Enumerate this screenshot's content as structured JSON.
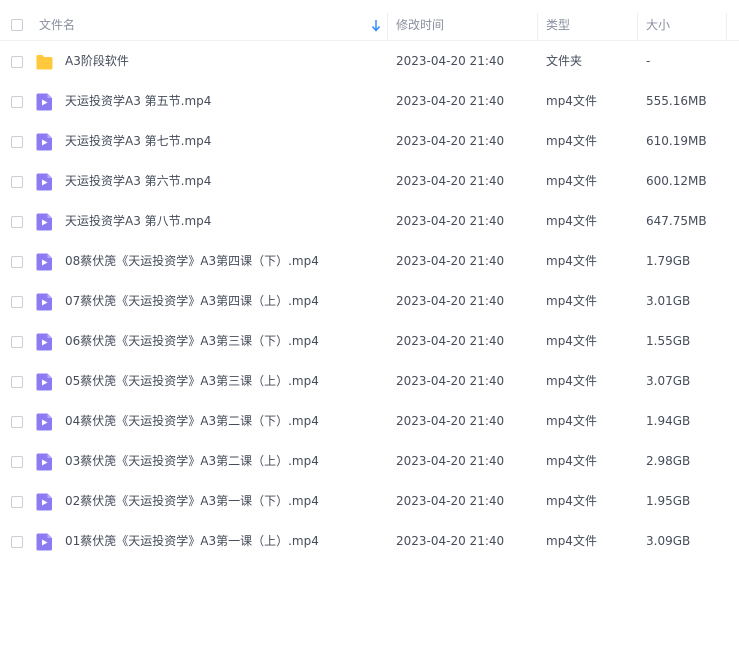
{
  "header": {
    "name_label": "文件名",
    "time_label": "修改时间",
    "type_label": "类型",
    "size_label": "大小"
  },
  "colors": {
    "folder": "#ffc83d",
    "video": "#8c7cf3",
    "header_text": "#8a90a0",
    "sort_arrow": "#2f8cff"
  },
  "rows": [
    {
      "icon": "folder-icon",
      "name": "A3阶段软件",
      "time": "2023-04-20 21:40",
      "type": "文件夹",
      "size": "-"
    },
    {
      "icon": "video-icon",
      "name": "天运投资学A3 第五节.mp4",
      "time": "2023-04-20 21:40",
      "type": "mp4文件",
      "size": "555.16MB"
    },
    {
      "icon": "video-icon",
      "name": "天运投资学A3 第七节.mp4",
      "time": "2023-04-20 21:40",
      "type": "mp4文件",
      "size": "610.19MB"
    },
    {
      "icon": "video-icon",
      "name": "天运投资学A3 第六节.mp4",
      "time": "2023-04-20 21:40",
      "type": "mp4文件",
      "size": "600.12MB"
    },
    {
      "icon": "video-icon",
      "name": "天运投资学A3 第八节.mp4",
      "time": "2023-04-20 21:40",
      "type": "mp4文件",
      "size": "647.75MB"
    },
    {
      "icon": "video-icon",
      "name": "08蔡伏箎《天运投资学》A3第四课（下）.mp4",
      "time": "2023-04-20 21:40",
      "type": "mp4文件",
      "size": "1.79GB"
    },
    {
      "icon": "video-icon",
      "name": "07蔡伏箎《天运投资学》A3第四课（上）.mp4",
      "time": "2023-04-20 21:40",
      "type": "mp4文件",
      "size": "3.01GB"
    },
    {
      "icon": "video-icon",
      "name": "06蔡伏箎《天运投资学》A3第三课（下）.mp4",
      "time": "2023-04-20 21:40",
      "type": "mp4文件",
      "size": "1.55GB"
    },
    {
      "icon": "video-icon",
      "name": "05蔡伏箎《天运投资学》A3第三课（上）.mp4",
      "time": "2023-04-20 21:40",
      "type": "mp4文件",
      "size": "3.07GB"
    },
    {
      "icon": "video-icon",
      "name": "04蔡伏箎《天运投资学》A3第二课（下）.mp4",
      "time": "2023-04-20 21:40",
      "type": "mp4文件",
      "size": "1.94GB"
    },
    {
      "icon": "video-icon",
      "name": "03蔡伏箎《天运投资学》A3第二课（上）.mp4",
      "time": "2023-04-20 21:40",
      "type": "mp4文件",
      "size": "2.98GB"
    },
    {
      "icon": "video-icon",
      "name": "02蔡伏箎《天运投资学》A3第一课（下）.mp4",
      "time": "2023-04-20 21:40",
      "type": "mp4文件",
      "size": "1.95GB"
    },
    {
      "icon": "video-icon",
      "name": "01蔡伏箎《天运投资学》A3第一课（上）.mp4",
      "time": "2023-04-20 21:40",
      "type": "mp4文件",
      "size": "3.09GB"
    }
  ]
}
